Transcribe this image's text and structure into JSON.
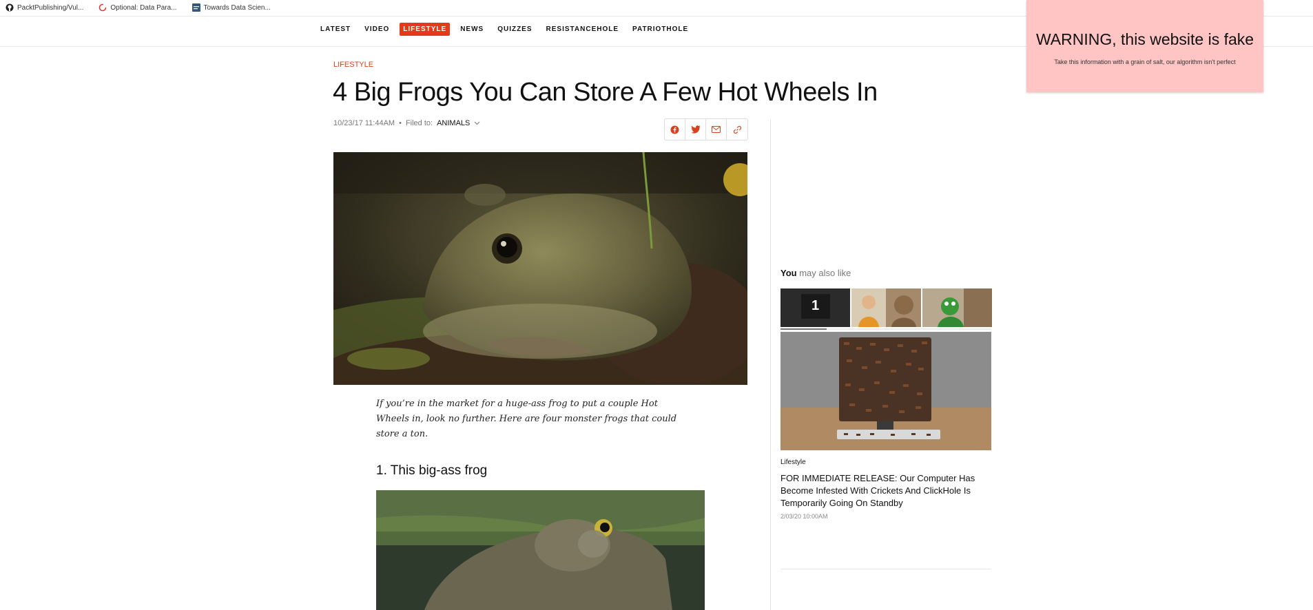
{
  "bookmarks": [
    {
      "label": "PacktPublishing/Vul...",
      "icon": "github-icon"
    },
    {
      "label": "Optional: Data Para...",
      "icon": "red-ring-icon"
    },
    {
      "label": "Towards Data Scien...",
      "icon": "tds-icon"
    }
  ],
  "nav": {
    "items": [
      "LATEST",
      "VIDEO",
      "LIFESTYLE",
      "NEWS",
      "QUIZZES",
      "RESISTANCEHOLE",
      "PATRIOTHOLE"
    ],
    "active": "LIFESTYLE",
    "accent": "#e23a1b"
  },
  "article": {
    "category": "LIFESTYLE",
    "title": "4 Big Frogs You Can Store A Few Hot Wheels In",
    "timestamp": "10/23/17 11:44AM",
    "filed_label": "Filed to:",
    "filed_tag": "ANIMALS",
    "share_icons": [
      "facebook-icon",
      "twitter-icon",
      "email-icon",
      "link-icon"
    ],
    "intro": "If you’re in the market for a huge-ass frog to put a couple Hot Wheels in, look no further. Here are four monster frogs that could store a ton.",
    "section_heading": "1. This big-ass frog"
  },
  "sidebar": {
    "heading_bold": "You",
    "heading_rest": " may also like",
    "thumb_number": "1",
    "carousel_progress": 0.22,
    "rec_category": "Lifestyle",
    "rec_title": "FOR IMMEDIATE RELEASE: Our Computer Has Become Infested With Crickets And ClickHole Is Temporarily Going On Standby",
    "rec_date": "2/03/20 10:00AM"
  },
  "warning": {
    "title": "WARNING, this website is fake",
    "text": "Take this information with a grain of salt, our algorithm isn't perfect",
    "color": "#ffc4c4"
  }
}
